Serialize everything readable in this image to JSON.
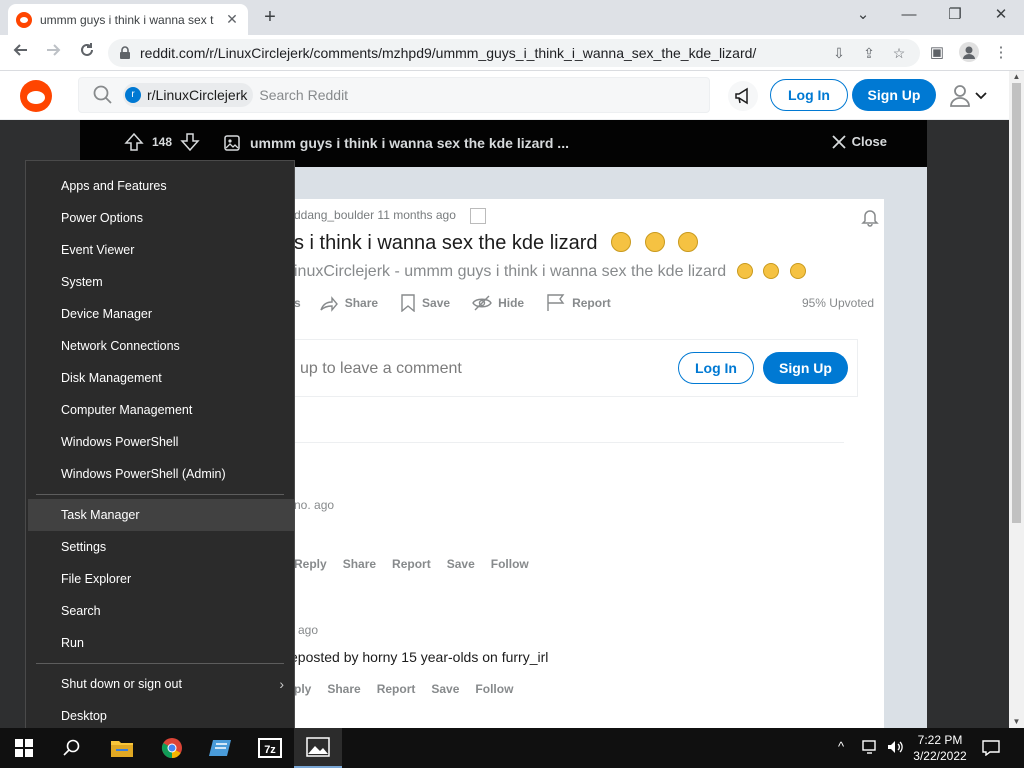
{
  "browser": {
    "tab_title": "ummm guys i think i wanna sex t",
    "tab_close": "✕",
    "new_tab": "+",
    "url": "reddit.com/r/LinuxCirclejerk/comments/mzhpd9/ummm_guys_i_think_i_wanna_sex_the_kde_lizard/",
    "window_min": "⌄",
    "window_minimize": "—",
    "window_restore": "❐",
    "window_close": "✕"
  },
  "reddit_header": {
    "subreddit_chip": "r/LinuxCirclejerk",
    "search_placeholder": "Search Reddit",
    "login_label": "Log In",
    "signup_label": "Sign Up"
  },
  "post_bar": {
    "score": "148",
    "title": "ummm guys i think i wanna sex the kde lizard ...",
    "close_label": "Close"
  },
  "post": {
    "meta": "ddang_boulder 11 months ago",
    "title": "s i think i wanna sex the kde lizard",
    "subtitle": "inuxCirclejerk - ummm guys i think i wanna sex the kde lizard",
    "actions": {
      "share": "Share",
      "save": "Save",
      "hide": "Hide",
      "report": "Report",
      "frag": "s"
    },
    "upvoted": "95% Upvoted"
  },
  "comment_box": {
    "prompt": "up to leave a comment",
    "login_label": "Log In",
    "signup_label": "Sign Up"
  },
  "comments": [
    {
      "time": "no. ago",
      "actions": [
        "Reply",
        "Share",
        "Report",
        "Save",
        "Follow"
      ]
    },
    {
      "time": "ago",
      "body": "eposted by horny 15 year-olds on furry_irl",
      "actions": [
        "ply",
        "Share",
        "Report",
        "Save",
        "Follow"
      ]
    }
  ],
  "winx_menu": {
    "items": [
      "Apps and Features",
      "Power Options",
      "Event Viewer",
      "System",
      "Device Manager",
      "Network Connections",
      "Disk Management",
      "Computer Management",
      "Windows PowerShell",
      "Windows PowerShell (Admin)",
      "Task Manager",
      "Settings",
      "File Explorer",
      "Search",
      "Run",
      "Shut down or sign out",
      "Desktop"
    ],
    "active_item": "Task Manager"
  },
  "taskbar": {
    "time": "7:22 PM",
    "date": "3/22/2022"
  },
  "colors": {
    "reddit_orange": "#ff4500",
    "reddit_blue": "#0079d3",
    "menu_bg": "#2b2b2b",
    "taskbar_bg": "#101010"
  }
}
